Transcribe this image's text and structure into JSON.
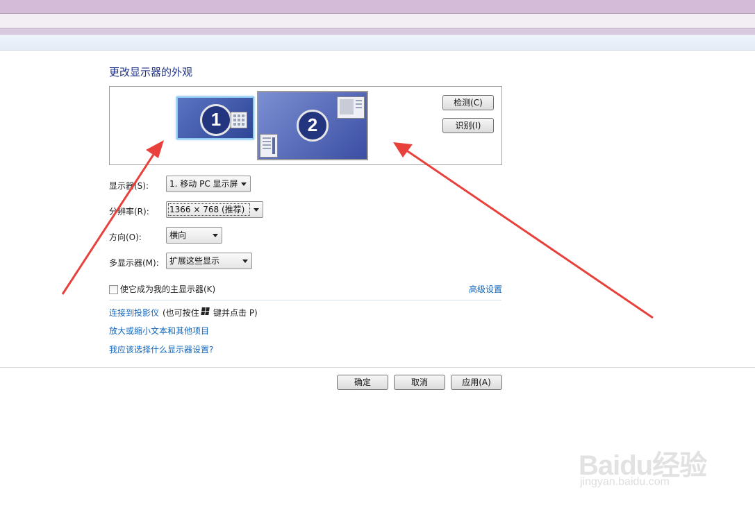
{
  "page": {
    "title": "更改显示器的外观"
  },
  "preview": {
    "monitors": [
      {
        "number": "1",
        "selected": true
      },
      {
        "number": "2",
        "selected": false
      }
    ],
    "detect_label": "检测(C)",
    "identify_label": "识别(I)"
  },
  "settings": {
    "display_label": "显示器(S):",
    "display_value": "1. 移动 PC 显示屏",
    "resolution_label": "分辨率(R):",
    "resolution_value": "1366 × 768 (推荐)",
    "orientation_label": "方向(O):",
    "orientation_value": "横向",
    "multi_label": "多显示器(M):",
    "multi_value": "扩展这些显示",
    "primary_checkbox_label": "使它成为我的主显示器(K)",
    "primary_checked": false,
    "advanced_link": "高级设置"
  },
  "links": {
    "projector": "连接到投影仪",
    "projector_hint_a": "(也可按住",
    "projector_hint_b": "键并点击 P)",
    "text_size": "放大或缩小文本和其他项目",
    "help": "我应该选择什么显示器设置?"
  },
  "footer": {
    "ok_label": "确定",
    "cancel_label": "取消",
    "apply_label": "应用(A)"
  },
  "watermark": {
    "brand": "Baidu经验",
    "url": "jingyan.baidu.com"
  },
  "colors": {
    "accent_link": "#1166bb",
    "title": "#1e3287",
    "arrow": "#e8413c"
  }
}
